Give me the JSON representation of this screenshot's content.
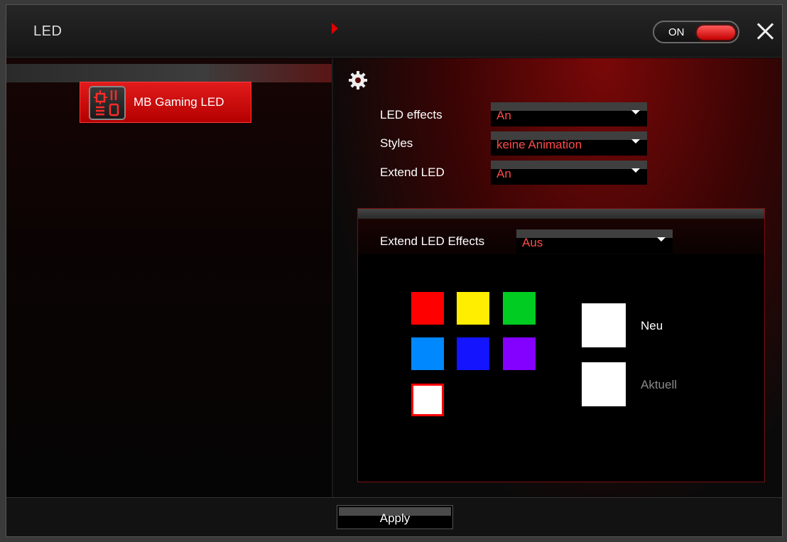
{
  "window": {
    "title": "LED"
  },
  "power_toggle": {
    "label": "ON",
    "state": "on",
    "accent": "#e00000"
  },
  "sidebar": {
    "items": [
      {
        "label": "MB Gaming LED",
        "icon": "motherboard-icon",
        "selected": true
      }
    ]
  },
  "settings": {
    "icon": "gear-icon",
    "led_effects": {
      "label": "LED effects",
      "value": "An"
    },
    "styles": {
      "label": "Styles",
      "value": "keine Animation"
    },
    "extend_led": {
      "label": "Extend LED",
      "value": "An"
    }
  },
  "extend_panel": {
    "label": "Extend LED Effects",
    "value": "Aus",
    "palette": [
      {
        "name": "red",
        "color": "#ff0000"
      },
      {
        "name": "yellow",
        "color": "#ffee00"
      },
      {
        "name": "green",
        "color": "#00cc22"
      },
      {
        "name": "light-blue",
        "color": "#0088ff"
      },
      {
        "name": "blue",
        "color": "#1414ff"
      },
      {
        "name": "purple",
        "color": "#8400ff"
      },
      {
        "name": "white",
        "color": "#ffffff",
        "selected": true
      }
    ],
    "new_color": {
      "label": "Neu",
      "color": "#ffffff"
    },
    "current_color": {
      "label": "Aktuell",
      "color": "#ffffff"
    }
  },
  "footer": {
    "apply_label": "Apply"
  }
}
